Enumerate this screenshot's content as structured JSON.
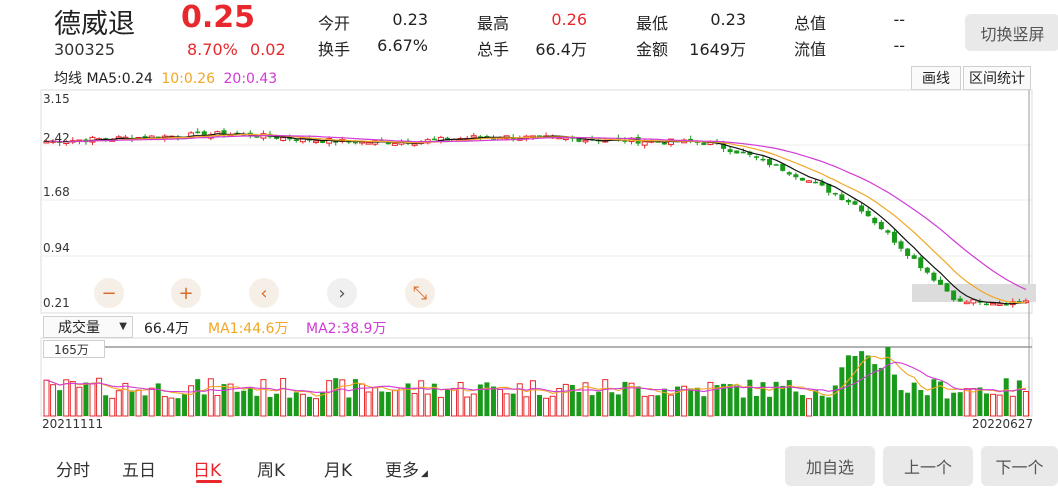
{
  "stock": {
    "name": "德威退",
    "code": "300325",
    "price": "0.25",
    "change_pct": "8.70%",
    "change": "0.02"
  },
  "quote": {
    "open_label": "今开",
    "open": "0.23",
    "high_label": "最高",
    "high": "0.26",
    "low_label": "最低",
    "low": "0.23",
    "total_value_label": "总值",
    "total_value": "--",
    "turnover_label": "换手",
    "turnover": "6.67%",
    "total_vol_label": "总手",
    "total_vol": "66.4万",
    "amount_label": "金额",
    "amount": "1649万",
    "float_value_label": "流值",
    "float_value": "--"
  },
  "toolbar": {
    "switch_label": "切换竖屏",
    "draw_label": "画线",
    "range_label": "区间统计"
  },
  "ma": {
    "label": "均线",
    "ma5": "MA5:0.24",
    "ma10": "10:0.26",
    "ma20": "20:0.43"
  },
  "colors": {
    "up": "#e8282c",
    "down": "#1a9a1a",
    "ma5": "#111111",
    "ma10": "#f2a623",
    "ma20": "#d13bd6"
  },
  "zoom": {
    "zoom_out_icon": "minus-icon",
    "zoom_in_icon": "plus-icon",
    "left_icon": "chevron-left-icon",
    "right_icon": "chevron-right-icon",
    "reset_icon": "shrink-arrows-icon",
    "zoom_out": "−",
    "zoom_in": "+",
    "left": "‹",
    "right": "›",
    "reset": "⤡"
  },
  "volume": {
    "selector": "成交量",
    "value": "66.4万",
    "ma1": "MA1:44.6万",
    "ma2": "MA2:38.9万",
    "max_label": "165万"
  },
  "chart_data": {
    "type": "candlestick",
    "y_ticks": [
      "3.15",
      "2.42",
      "1.68",
      "0.94",
      "0.21"
    ],
    "x_start": "20211111",
    "x_end": "20220627"
  },
  "tabs": [
    "分时",
    "五日",
    "日K",
    "周K",
    "月K",
    "更多"
  ],
  "active_tab": "日K",
  "nav": {
    "add_watch": "加自选",
    "prev": "上一个",
    "next": "下一个"
  }
}
